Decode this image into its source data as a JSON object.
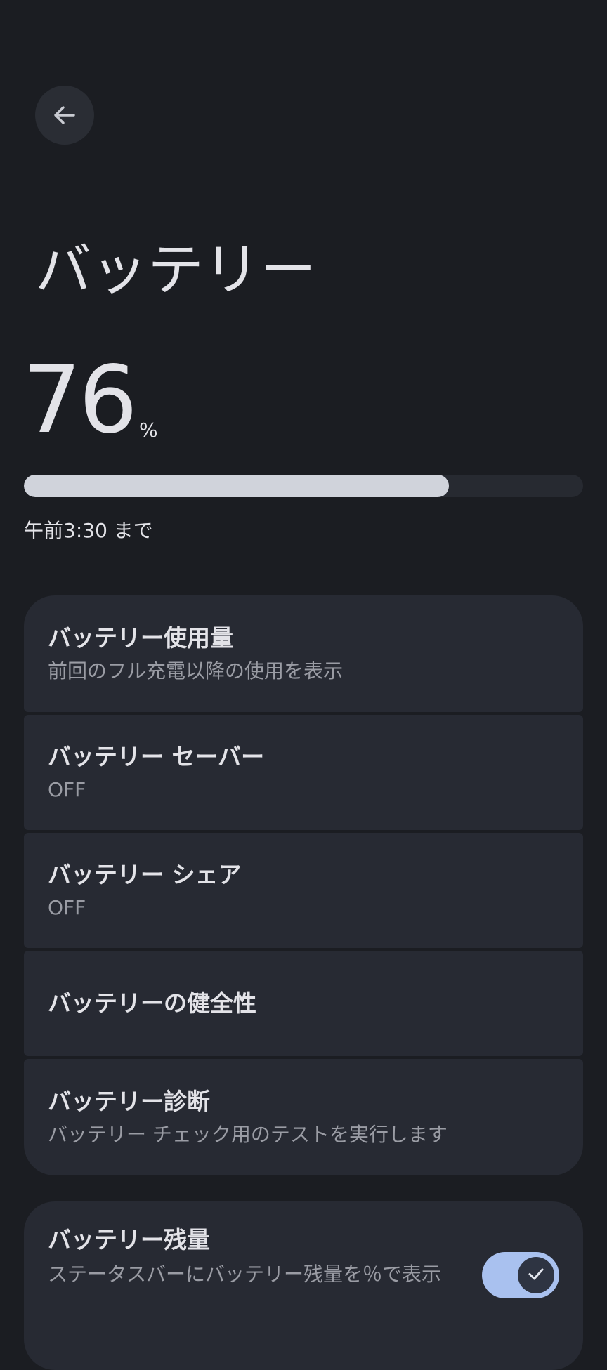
{
  "header": {
    "back_icon": "arrow-back-icon",
    "title": "バッテリー"
  },
  "battery": {
    "level": "76",
    "unit": "%",
    "level_fraction": 0.76,
    "estimate": "午前3:30 まで"
  },
  "items": [
    {
      "title": "バッテリー使用量",
      "subtitle": "前回のフル充電以降の使用を表示"
    },
    {
      "title": "バッテリー セーバー",
      "subtitle": "OFF"
    },
    {
      "title": "バッテリー シェア",
      "subtitle": "OFF"
    },
    {
      "title": "バッテリーの健全性"
    },
    {
      "title": "バッテリー診断",
      "subtitle": "バッテリー チェック用のテストを実行します"
    }
  ],
  "percentage_setting": {
    "title": "バッテリー残量",
    "subtitle": "ステータスバーにバッテリー残量を％で表示",
    "toggle_on": true,
    "toggle_icon": "check-icon"
  },
  "colors": {
    "background": "#1b1d22",
    "card": "#272a33",
    "progress_fill": "#d0d3db",
    "toggle_on": "#a9c1ef"
  }
}
